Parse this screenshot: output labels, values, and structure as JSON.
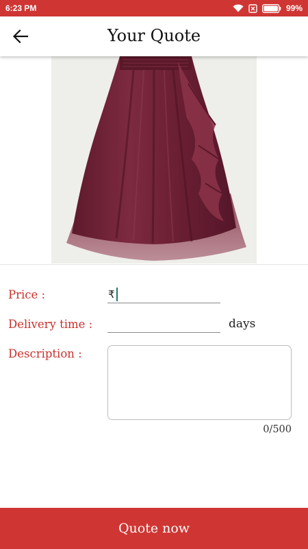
{
  "status_bar": {
    "time": "6:23 PM",
    "battery_percent": "99%",
    "icons": [
      "wifi-icon",
      "no-sim-icon",
      "battery-icon"
    ],
    "color": "#cf3633"
  },
  "app_bar": {
    "title": "Your Quote",
    "back_icon": "arrow-left-icon"
  },
  "product": {
    "image": "maroon-chiffon-skirt-photo"
  },
  "form": {
    "price_label": "Price :",
    "currency_symbol": "₹",
    "price_value": "",
    "delivery_label": "Delivery time :",
    "delivery_value": "",
    "delivery_unit": "days",
    "description_label": "Description :",
    "description_value": "",
    "char_counter": "0/500",
    "label_color": "#c9302c"
  },
  "footer": {
    "button_label": "Quote now",
    "color": "#cf3633"
  }
}
